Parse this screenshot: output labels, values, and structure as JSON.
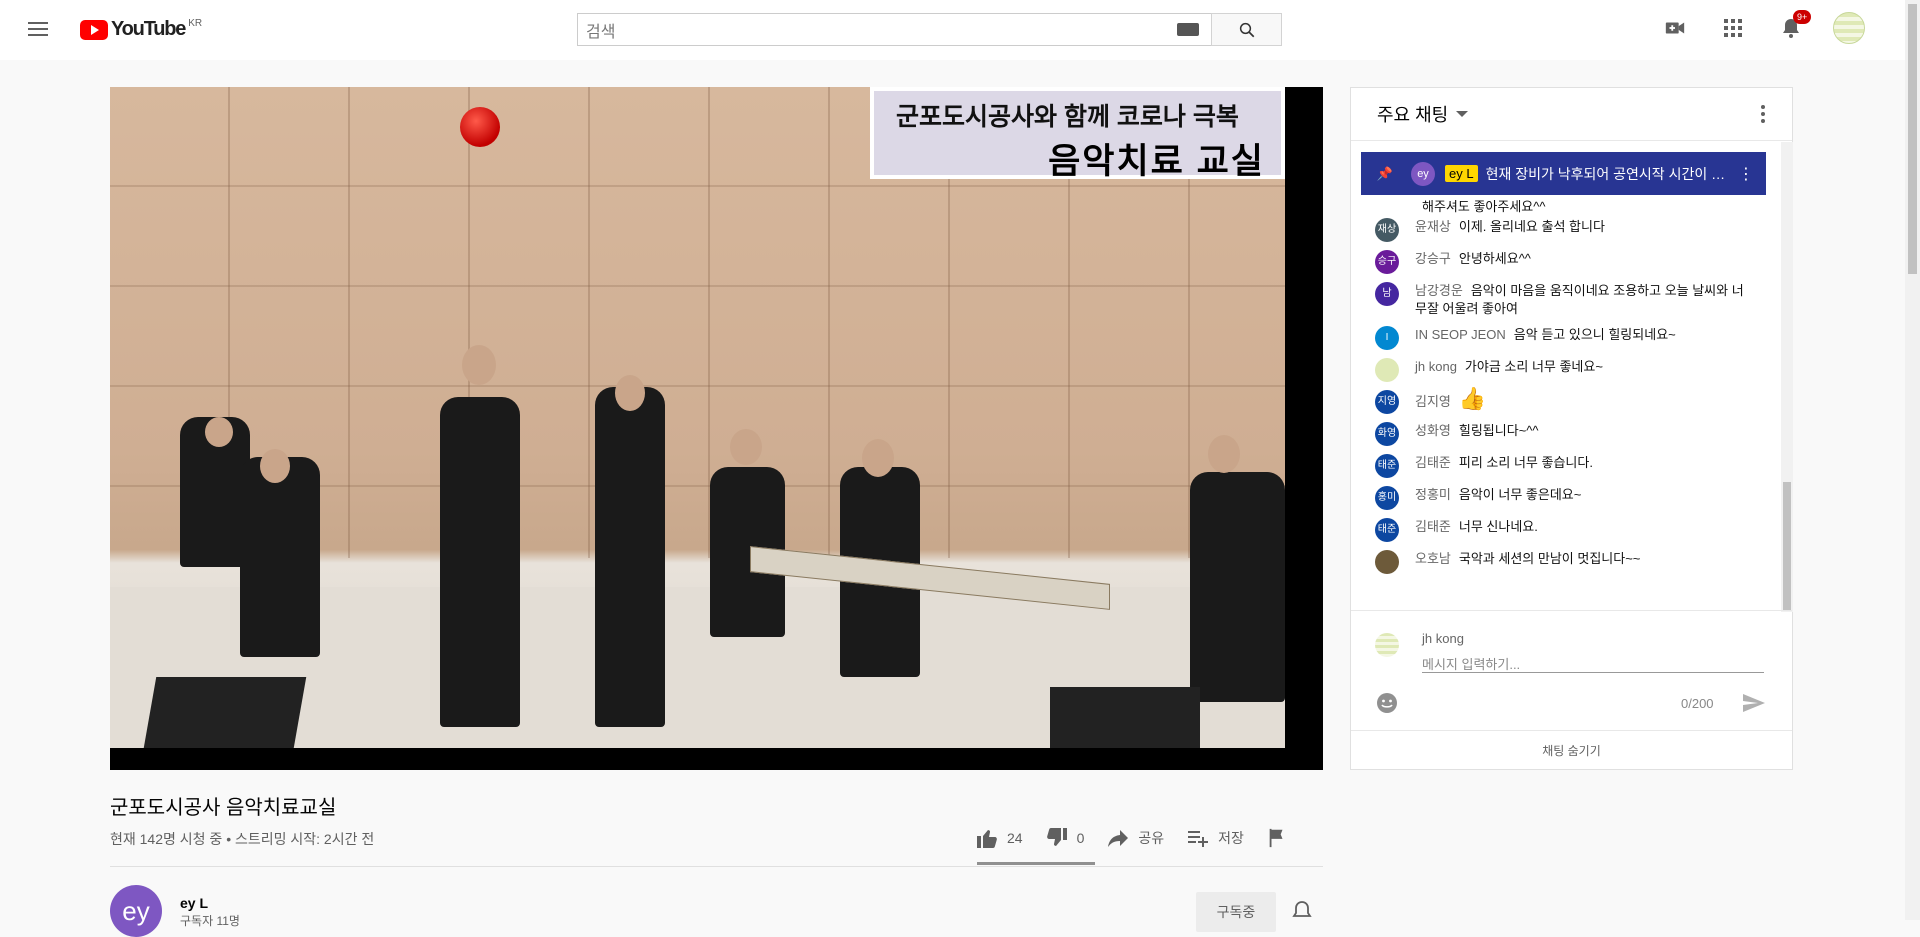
{
  "header": {
    "logo_text": "YouTube",
    "logo_country": "KR",
    "search_placeholder": "검색",
    "notification_count": "9+"
  },
  "video": {
    "overlay_line1": "군포도시공사와 함께 코로나 극복",
    "overlay_line2": "음악치료 교실",
    "title": "군포도시공사 음악치료교실",
    "meta": "현재 142명 시청 중 • 스트리밍 시작: 2시간 전",
    "likes": "24",
    "dislikes": "0",
    "share_label": "공유",
    "save_label": "저장",
    "like_ratio": 1.0
  },
  "channel": {
    "avatar_text": "ey",
    "name": "ey L",
    "subscribers": "구독자 11명",
    "subscribe_label": "구독중"
  },
  "chat": {
    "header_label": "주요 채팅",
    "pinned": {
      "avatar_text": "ey",
      "author": "ey L",
      "text": "현재 장비가 낙후되어 공연시작 시간이 지연되었습니다. 양해 부탁드립니다."
    },
    "partial_message": "해주셔도 좋아주세요^^",
    "messages": [
      {
        "avatar": "재상",
        "color": "#455a64",
        "author": "윤재상",
        "text": "이제. 올리네요 출석 합니다"
      },
      {
        "avatar": "승구",
        "color": "#6a1b9a",
        "author": "강승구",
        "text": "안녕하세요^^"
      },
      {
        "avatar": "남",
        "color": "#4527a0",
        "author": "남강경운",
        "text": "음악이 마음을 움직이네요 조용하고 오늘 날씨와 너무잘 어울려 좋아여"
      },
      {
        "avatar": "I",
        "color": "#0288d1",
        "author": "IN SEOP JEON",
        "text": "음악 듣고 있으니 힐링되네요~"
      },
      {
        "avatar": "",
        "color": "#dfe9b6",
        "author": "jh kong",
        "text": "가야금 소리 너무 좋네요~"
      },
      {
        "avatar": "지영",
        "color": "#0d47a1",
        "author": "김지영",
        "text": "👍"
      },
      {
        "avatar": "화영",
        "color": "#0d47a1",
        "author": "성화영",
        "text": "힐링됩니다~^^"
      },
      {
        "avatar": "태준",
        "color": "#0d47a1",
        "author": "김태준",
        "text": "피리 소리 너무 좋습니다."
      },
      {
        "avatar": "홍미",
        "color": "#0d47a1",
        "author": "정홍미",
        "text": "음악이 너무 좋은데요~"
      },
      {
        "avatar": "태준",
        "color": "#0d47a1",
        "author": "김태준",
        "text": "너무 신나네요."
      },
      {
        "avatar": "",
        "color": "#6d5a3a",
        "author": "오호남",
        "text": "국악과 세션의 만남이 멋집니다~~"
      }
    ],
    "input_user": "jh kong",
    "input_placeholder": "메시지 입력하기...",
    "char_count": "0/200",
    "hide_label": "채팅 숨기기"
  }
}
